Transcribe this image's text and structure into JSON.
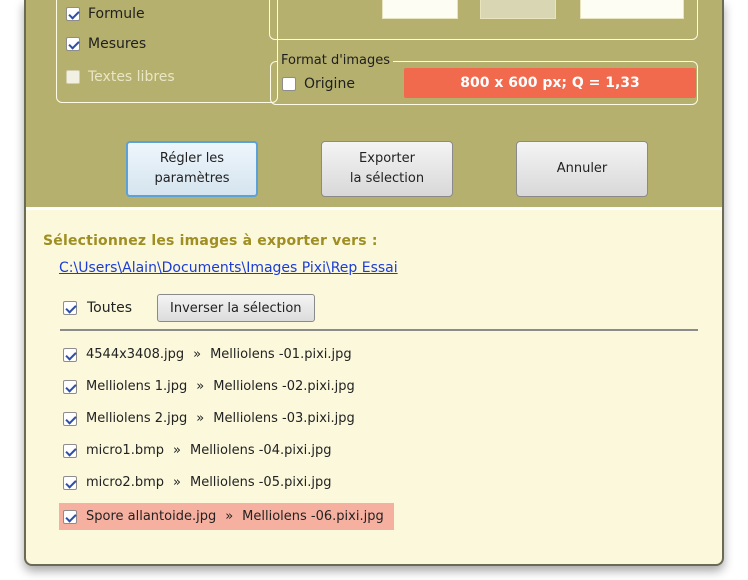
{
  "options": {
    "formule": {
      "label": "Formule",
      "checked": true
    },
    "mesures": {
      "label": "Mesures",
      "checked": true
    },
    "textes_libres": {
      "label": "Textes libres",
      "checked": false,
      "enabled": false
    }
  },
  "format": {
    "legend": "Format d'images",
    "origine_label": "Origine",
    "origine_checked": false,
    "value": "800 x 600 px; Q = 1,33"
  },
  "buttons": {
    "regler_line1": "Régler les",
    "regler_line2": "paramètres",
    "exporter_line1": "Exporter",
    "exporter_line2": "la sélection",
    "annuler": "Annuler"
  },
  "selection": {
    "title": "Sélectionnez les images à exporter vers :",
    "path": "C:\\Users\\Alain\\Documents\\Images Pixi\\Rep Essai",
    "toutes_label": "Toutes",
    "toutes_checked": true,
    "invert_label": "Inverser la sélection"
  },
  "files": [
    {
      "source": "4544x3408.jpg",
      "arrow": "»",
      "target": "Melliolens -01.pixi.jpg",
      "checked": true
    },
    {
      "source": "Melliolens 1.jpg",
      "arrow": "»",
      "target": "Melliolens -02.pixi.jpg",
      "checked": true
    },
    {
      "source": "Melliolens 2.jpg",
      "arrow": "»",
      "target": "Melliolens -03.pixi.jpg",
      "checked": true
    },
    {
      "source": "micro1.bmp",
      "arrow": "»",
      "target": "Melliolens -04.pixi.jpg",
      "checked": true
    },
    {
      "source": "micro2.bmp",
      "arrow": "»",
      "target": "Melliolens -05.pixi.jpg",
      "checked": true
    },
    {
      "source": "Spore allantoide.jpg",
      "arrow": "»",
      "target": "Melliolens -06.pixi.jpg",
      "checked": true,
      "highlighted": true
    }
  ],
  "colors": {
    "top_panel": "#b5b06e",
    "bottom_panel": "#fbf8dc",
    "format_bar": "#f16a4e",
    "title_text": "#9f8e21",
    "link": "#1b3cd6",
    "highlight_row": "#f6b0a0"
  }
}
